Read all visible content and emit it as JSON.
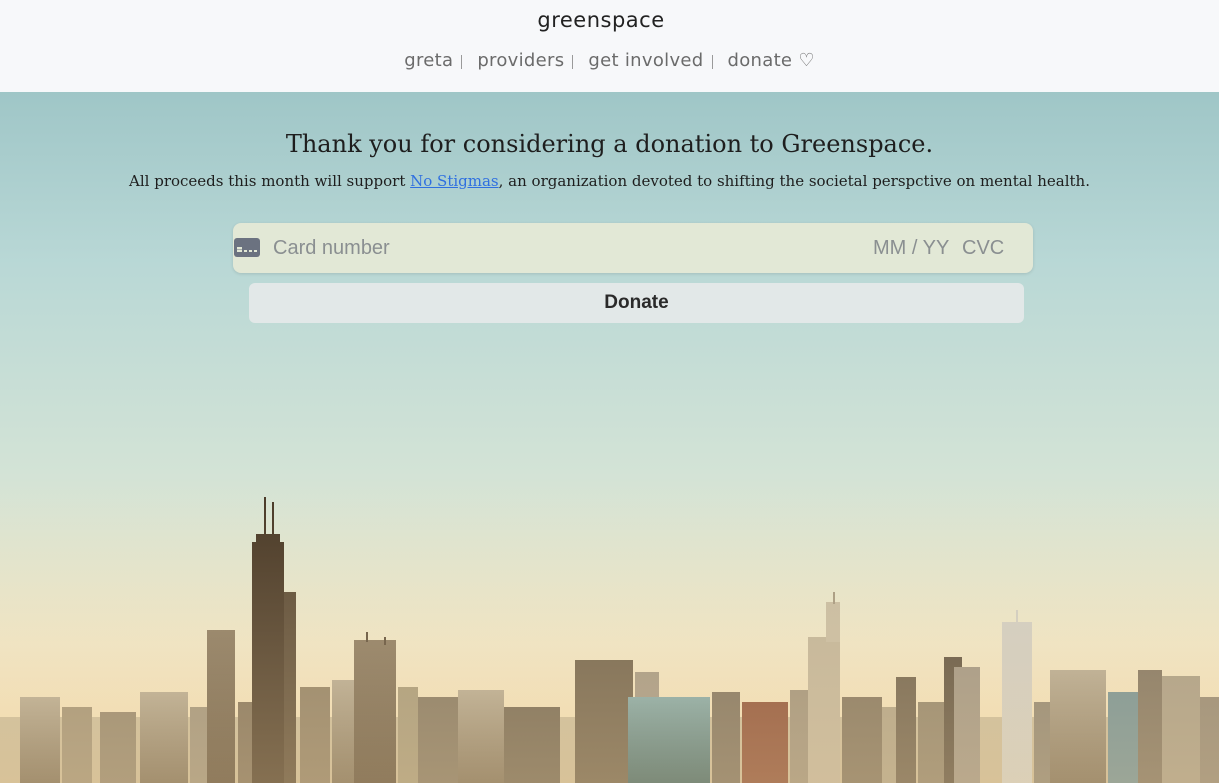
{
  "header": {
    "brand": "greenspace",
    "nav": [
      {
        "label": "greta"
      },
      {
        "label": "providers"
      },
      {
        "label": "get involved"
      },
      {
        "label": "donate ♡"
      }
    ]
  },
  "main": {
    "title": "Thank you for considering a donation to Greenspace.",
    "subtitle_prefix": "All proceeds this month will support ",
    "subtitle_link": "No Stigmas",
    "subtitle_suffix": ", an organization devoted to shifting the societal perspctive on mental health."
  },
  "payment": {
    "card_number_placeholder": "Card number",
    "expiry_placeholder": "MM / YY",
    "cvc_placeholder": "CVC",
    "icon": "credit-card-icon",
    "donate_label": "Donate"
  },
  "colors": {
    "link": "#2f6fe0",
    "card_field_bg": "#e2e8d6",
    "button_bg": "#e2e8e8"
  }
}
